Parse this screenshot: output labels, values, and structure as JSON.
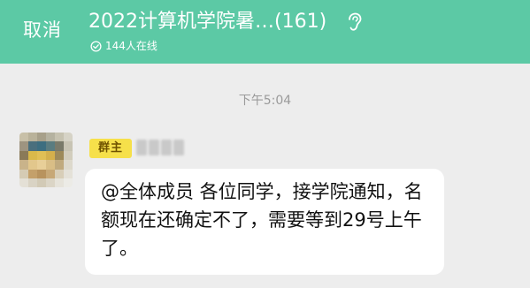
{
  "header": {
    "cancel_label": "取消",
    "group_title": "2022计算机学院暑…(161)",
    "online_count_text": "144人在线",
    "ear_icon": "ear-icon",
    "online_icon": "online-check-icon",
    "bg_color": "#5cc9a5"
  },
  "chat": {
    "timestamp": "下午5:04",
    "messages": [
      {
        "role_badge": "群主",
        "badge_color": "#f6e04a",
        "text": "@全体成员 各位同学，接学院通知，名额现在还确定不了，需要等到29号上午了。"
      }
    ]
  }
}
